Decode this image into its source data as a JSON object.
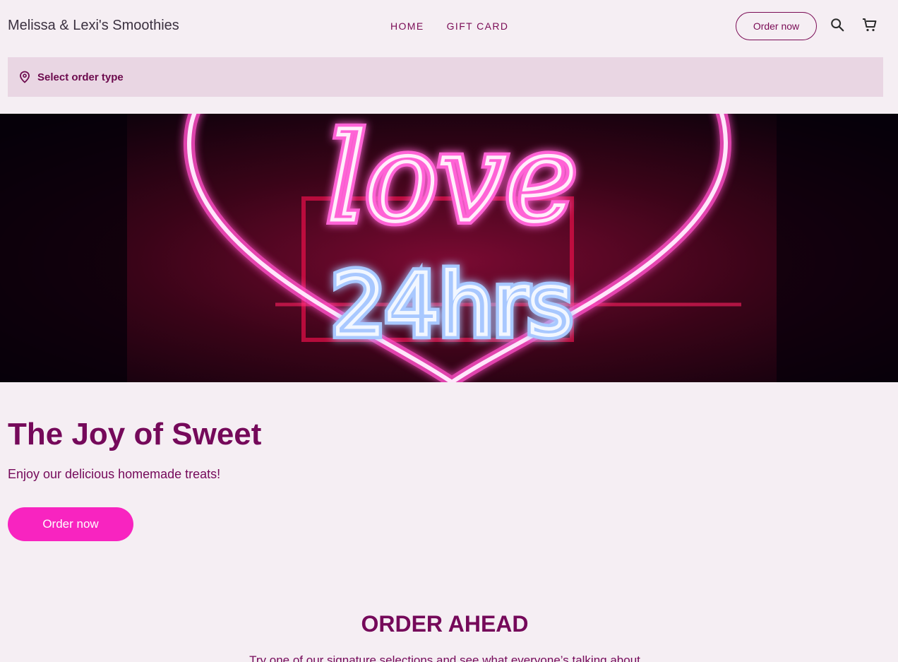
{
  "brand": "Melissa & Lexi's Smoothies",
  "nav": [
    "HOME",
    "GIFT CARD"
  ],
  "header": {
    "order_button": "Order now"
  },
  "icons": {
    "search": "search-icon",
    "cart": "cart-icon",
    "location": "location-pin-icon"
  },
  "order_type": {
    "label": "Select order type"
  },
  "hero": {
    "image_alt": "Neon sign reading love 24hrs inside a heart",
    "neon_word": "love",
    "neon_hours": "24hrs",
    "title": "The Joy of Sweet",
    "subtitle": "Enjoy our delicious homemade treats!",
    "cta": "Order now"
  },
  "section": {
    "title": "ORDER AHEAD",
    "subtitle": "Try one of our signature selections and see what everyone’s talking about"
  },
  "colors": {
    "accent": "#7a0b55",
    "cta": "#f824c0",
    "bg": "#f5eef3",
    "bar": "#e9d6e3"
  }
}
